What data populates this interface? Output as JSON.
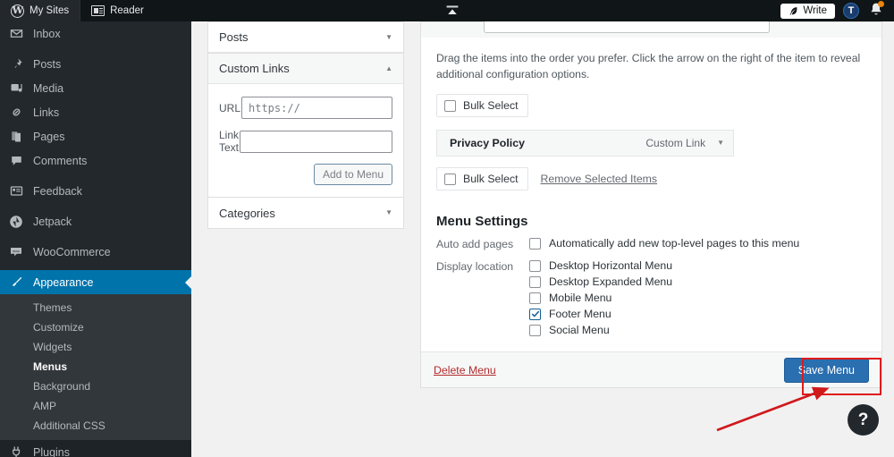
{
  "masterbar": {
    "my_sites": "My Sites",
    "reader": "Reader",
    "write": "Write",
    "avatar_letter": "T",
    "icons": {
      "wp_logo": "W",
      "reader_icon": "reader-icon",
      "collapse_icon": "collapse-icon",
      "quill_icon": "quill-icon",
      "bell_icon": "bell-icon"
    }
  },
  "sidebar": {
    "items": [
      {
        "label": "Inbox",
        "icon": "envelope-icon"
      },
      {
        "label": "Posts",
        "icon": "pin-icon"
      },
      {
        "label": "Media",
        "icon": "camera-icon"
      },
      {
        "label": "Links",
        "icon": "link-icon"
      },
      {
        "label": "Pages",
        "icon": "pages-icon"
      },
      {
        "label": "Comments",
        "icon": "comment-icon"
      },
      {
        "label": "Feedback",
        "icon": "feedback-icon"
      },
      {
        "label": "Jetpack",
        "icon": "jetpack-icon"
      },
      {
        "label": "WooCommerce",
        "icon": "woocommerce-icon"
      },
      {
        "label": "Appearance",
        "icon": "brush-icon"
      },
      {
        "label": "Plugins",
        "icon": "plug-icon"
      }
    ],
    "appearance_submenu": [
      "Themes",
      "Customize",
      "Widgets",
      "Menus",
      "Background",
      "AMP",
      "Additional CSS"
    ],
    "current_submenu": "Menus",
    "active_item": "Appearance",
    "accent": "#0073aa"
  },
  "add_items_panel": {
    "sections": [
      {
        "title": "Posts",
        "expanded": false
      },
      {
        "title": "Custom Links",
        "expanded": true
      },
      {
        "title": "Categories",
        "expanded": false
      }
    ],
    "custom_links": {
      "url_label": "URL",
      "url_value": "",
      "url_placeholder": "https://",
      "text_label": "Link Text",
      "text_value": "",
      "text_placeholder": "",
      "add_button": "Add to Menu"
    }
  },
  "main": {
    "menu_name_value": "",
    "hint": "Drag the items into the order you prefer. Click the arrow on the right of the item to reveal additional configuration options.",
    "bulk_select_top": "Bulk Select",
    "bulk_select_bottom": "Bulk Select",
    "remove_selected": "Remove Selected Items",
    "menu_items": [
      {
        "title": "Privacy Policy",
        "type": "Custom Link"
      }
    ],
    "settings": {
      "title": "Menu Settings",
      "auto_add_label": "Auto add pages",
      "auto_add_option": "Automatically add new top-level pages to this menu",
      "auto_add_checked": false,
      "display_location_label": "Display location",
      "locations": [
        {
          "label": "Desktop Horizontal Menu",
          "checked": false
        },
        {
          "label": "Desktop Expanded Menu",
          "checked": false
        },
        {
          "label": "Mobile Menu",
          "checked": false
        },
        {
          "label": "Footer Menu",
          "checked": true
        },
        {
          "label": "Social Menu",
          "checked": false
        }
      ]
    },
    "footer": {
      "delete_menu": "Delete Menu",
      "save_menu": "Save Menu",
      "save_color": "#2a6fb0"
    }
  },
  "annotation": {
    "highlight_color": "#e01b1b",
    "target": "Save Menu"
  },
  "help": {
    "label": "?"
  }
}
